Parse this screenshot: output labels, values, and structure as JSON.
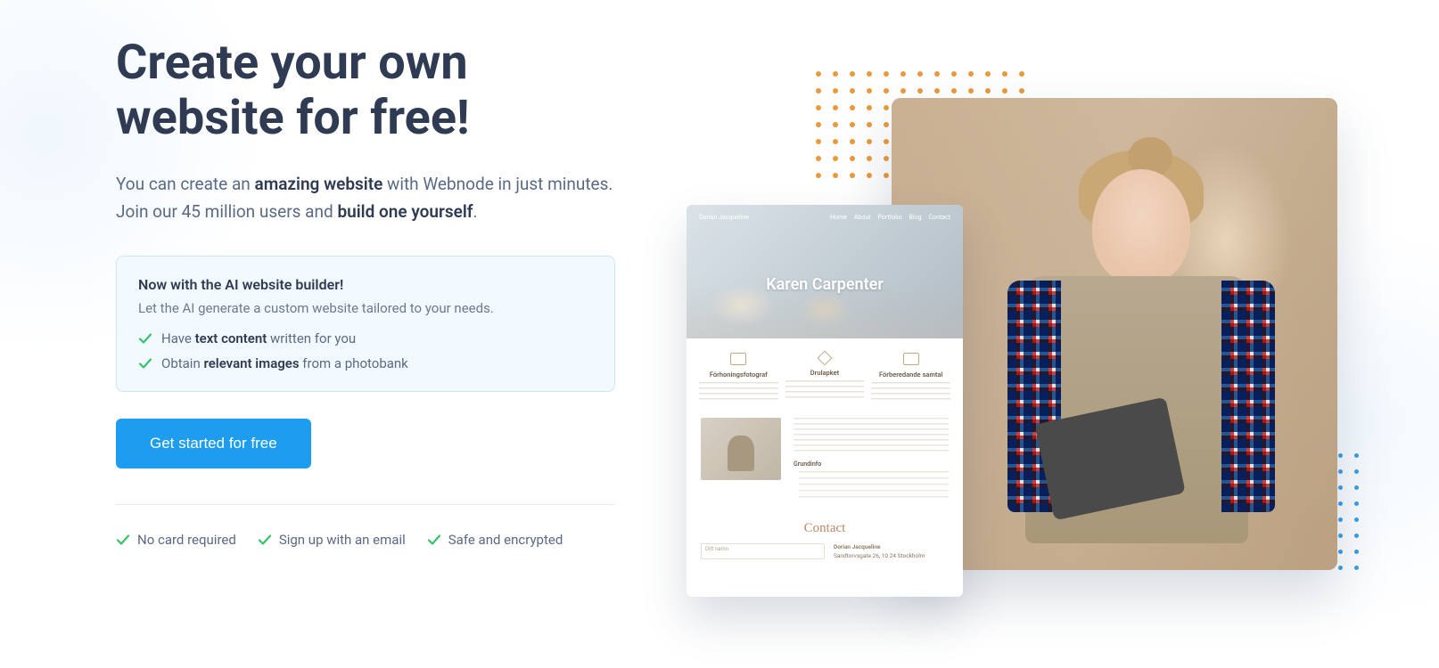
{
  "hero": {
    "headline": "Create your own website for free!",
    "sub_prefix": "You can create an ",
    "sub_bold1": "amazing website",
    "sub_mid": " with Webnode in just minutes. Join our 45 million users and ",
    "sub_bold2": "build one yourself",
    "sub_suffix": "."
  },
  "ai_box": {
    "title": "Now with the AI website builder!",
    "desc": "Let the AI generate a custom website tailored to your needs.",
    "feat1_pre": "Have ",
    "feat1_bold": "text content",
    "feat1_post": " written for you",
    "feat2_pre": "Obtain ",
    "feat2_bold": "relevant images",
    "feat2_post": " from a photobank"
  },
  "cta_label": "Get started for free",
  "trust": {
    "item1": "No card required",
    "item2": "Sign up with an email",
    "item3": "Safe and encrypted"
  },
  "mockup": {
    "nav_brand": "Dorian Jacqueline",
    "nav_items": [
      "Home",
      "About",
      "Portfolio",
      "Blog",
      "Contact"
    ],
    "hero_title": "Karen Carpenter",
    "feat_titles": [
      "Förhoningsfotograf",
      "Drulapket",
      "Förberedande samtal"
    ],
    "body_heading": "Grundinfo",
    "contact_heading": "Contact",
    "form_label": "Ditt namn",
    "contact_name": "Dorian Jacqueline",
    "contact_addr": "Sandtorvsgate 26, 10 24 Stockholm"
  },
  "icons": {
    "check": "check-icon"
  }
}
